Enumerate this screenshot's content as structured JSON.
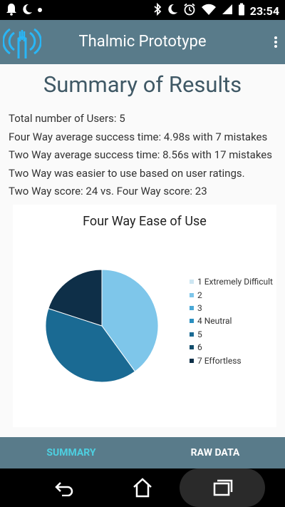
{
  "status_bar": {
    "time": "23:54",
    "icons_left": [
      "notification-bell-icon",
      "do-not-disturb-moon-icon",
      "dot-icon"
    ],
    "icons_right": [
      "bluetooth-icon",
      "do-not-disturb-moon-icon",
      "alarm-icon",
      "wifi-icon",
      "signal-icon",
      "battery-icon"
    ]
  },
  "app_bar": {
    "title": "Thalmic Prototype",
    "logo_icon": "broadcast-hand-logo",
    "menu_icon": "overflow-menu-icon"
  },
  "content": {
    "heading": "Summary of Results",
    "stats": [
      "Total number of Users: 5",
      "Four Way average success time: 4.98s with 7 mistakes",
      "Two Way average success time: 8.56s with 17 mistakes",
      "Two Way was easier to use based on user ratings.",
      "Two Way score: 24 vs. Four Way score: 23"
    ]
  },
  "chart_data": {
    "type": "pie",
    "title": "Four Way Ease of Use",
    "legend_position": "right",
    "labels": [
      "1 Extremely Difficult",
      "2",
      "3",
      "4 Neutral",
      "5",
      "6",
      "7 Effortless"
    ],
    "values": [
      0,
      2,
      0,
      0,
      2,
      0,
      1
    ],
    "colors": [
      "#cde6f2",
      "#7ec6ea",
      "#4aa8d6",
      "#2a8fc0",
      "#1a6a93",
      "#124d6c",
      "#0e2f48"
    ]
  },
  "tabs": [
    {
      "label": "SUMMARY",
      "active": true
    },
    {
      "label": "RAW DATA",
      "active": false
    }
  ],
  "nav_bar": {
    "buttons": [
      "back-icon",
      "home-icon",
      "recent-apps-icon"
    ]
  },
  "colors": {
    "app_bar": "#597b8a",
    "heading": "#3f5865",
    "active_tab": "#4dd0e1"
  }
}
